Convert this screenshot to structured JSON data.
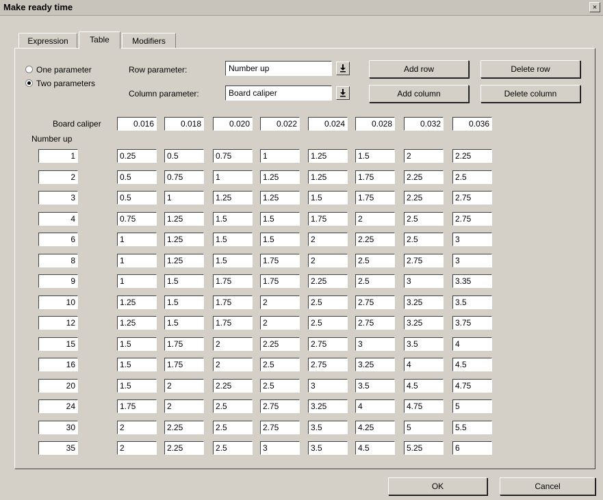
{
  "window": {
    "title": "Make ready time",
    "close_label": "×"
  },
  "tabs": [
    {
      "label": "Expression"
    },
    {
      "label": "Table"
    },
    {
      "label": "Modifiers"
    }
  ],
  "params": {
    "one_label": "One parameter",
    "two_label": "Two parameters",
    "selected": "two",
    "row_label": "Row parameter:",
    "row_value": "Number up",
    "col_label": "Column parameter:",
    "col_value": "Board caliper"
  },
  "buttons": {
    "add_row": "Add row",
    "delete_row": "Delete row",
    "add_column": "Add column",
    "delete_column": "Delete column",
    "ok": "OK",
    "cancel": "Cancel"
  },
  "table": {
    "col_header_label": "Board caliper",
    "row_header_label": "Number up",
    "columns": [
      "0.016",
      "0.018",
      "0.020",
      "0.022",
      "0.024",
      "0.028",
      "0.032",
      "0.036"
    ],
    "rows": [
      {
        "key": "1",
        "values": [
          "0.25",
          "0.5",
          "0.75",
          "1",
          "1.25",
          "1.5",
          "2",
          "2.25"
        ]
      },
      {
        "key": "2",
        "values": [
          "0.5",
          "0.75",
          "1",
          "1.25",
          "1.25",
          "1.75",
          "2.25",
          "2.5"
        ]
      },
      {
        "key": "3",
        "values": [
          "0.5",
          "1",
          "1.25",
          "1.25",
          "1.5",
          "1.75",
          "2.25",
          "2.75"
        ]
      },
      {
        "key": "4",
        "values": [
          "0.75",
          "1.25",
          "1.5",
          "1.5",
          "1.75",
          "2",
          "2.5",
          "2.75"
        ]
      },
      {
        "key": "6",
        "values": [
          "1",
          "1.25",
          "1.5",
          "1.5",
          "2",
          "2.25",
          "2.5",
          "3"
        ]
      },
      {
        "key": "8",
        "values": [
          "1",
          "1.25",
          "1.5",
          "1.75",
          "2",
          "2.5",
          "2.75",
          "3"
        ]
      },
      {
        "key": "9",
        "values": [
          "1",
          "1.5",
          "1.75",
          "1.75",
          "2.25",
          "2.5",
          "3",
          "3.35"
        ]
      },
      {
        "key": "10",
        "values": [
          "1.25",
          "1.5",
          "1.75",
          "2",
          "2.5",
          "2.75",
          "3.25",
          "3.5"
        ]
      },
      {
        "key": "12",
        "values": [
          "1.25",
          "1.5",
          "1.75",
          "2",
          "2.5",
          "2.75",
          "3.25",
          "3.75"
        ]
      },
      {
        "key": "15",
        "values": [
          "1.5",
          "1.75",
          "2",
          "2.25",
          "2.75",
          "3",
          "3.5",
          "4"
        ]
      },
      {
        "key": "16",
        "values": [
          "1.5",
          "1.75",
          "2",
          "2.5",
          "2.75",
          "3.25",
          "4",
          "4.5"
        ]
      },
      {
        "key": "20",
        "values": [
          "1.5",
          "2",
          "2.25",
          "2.5",
          "3",
          "3.5",
          "4.5",
          "4.75"
        ]
      },
      {
        "key": "24",
        "values": [
          "1.75",
          "2",
          "2.5",
          "2.75",
          "3.25",
          "4",
          "4.75",
          "5"
        ]
      },
      {
        "key": "30",
        "values": [
          "2",
          "2.25",
          "2.5",
          "2.75",
          "3.5",
          "4.25",
          "5",
          "5.5"
        ]
      },
      {
        "key": "35",
        "values": [
          "2",
          "2.25",
          "2.5",
          "3",
          "3.5",
          "4.5",
          "5.25",
          "6"
        ]
      }
    ]
  }
}
